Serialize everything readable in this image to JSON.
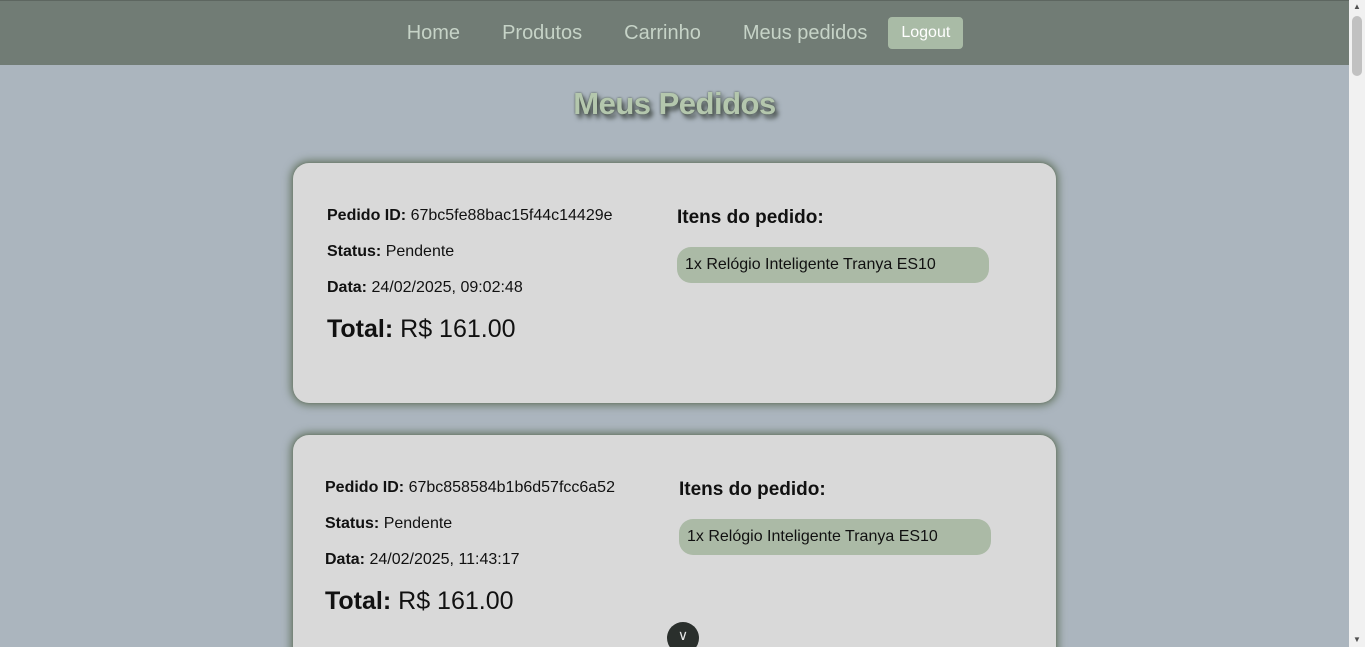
{
  "nav": {
    "links": [
      "Home",
      "Produtos",
      "Carrinho",
      "Meus pedidos"
    ],
    "logout_label": "Logout"
  },
  "page_title": "Meus Pedidos",
  "labels": {
    "order_id": "Pedido ID:",
    "status": "Status:",
    "date": "Data:",
    "total": "Total:",
    "items_title": "Itens do pedido:"
  },
  "orders": [
    {
      "id": "67bc5fe88bac15f44c14429e",
      "status": "Pendente",
      "date": "24/02/2025, 09:02:48",
      "total": "R$ 161.00",
      "items": [
        "1x Relógio Inteligente Tranya ES10"
      ]
    },
    {
      "id": "67bc858584b1b6d57fcc6a52",
      "status": "Pendente",
      "date": "24/02/2025, 11:43:17",
      "total": "R$ 161.00",
      "items": [
        "1x Relógio Inteligente Tranya ES10"
      ]
    }
  ],
  "colors": {
    "navbar": "#717c75",
    "background": "#abb5be",
    "card": "#d9d9d9",
    "item_pill": "#abbaa6",
    "logout": "#a9bba6"
  },
  "icons": {
    "float_button": "chevron-down-icon"
  }
}
